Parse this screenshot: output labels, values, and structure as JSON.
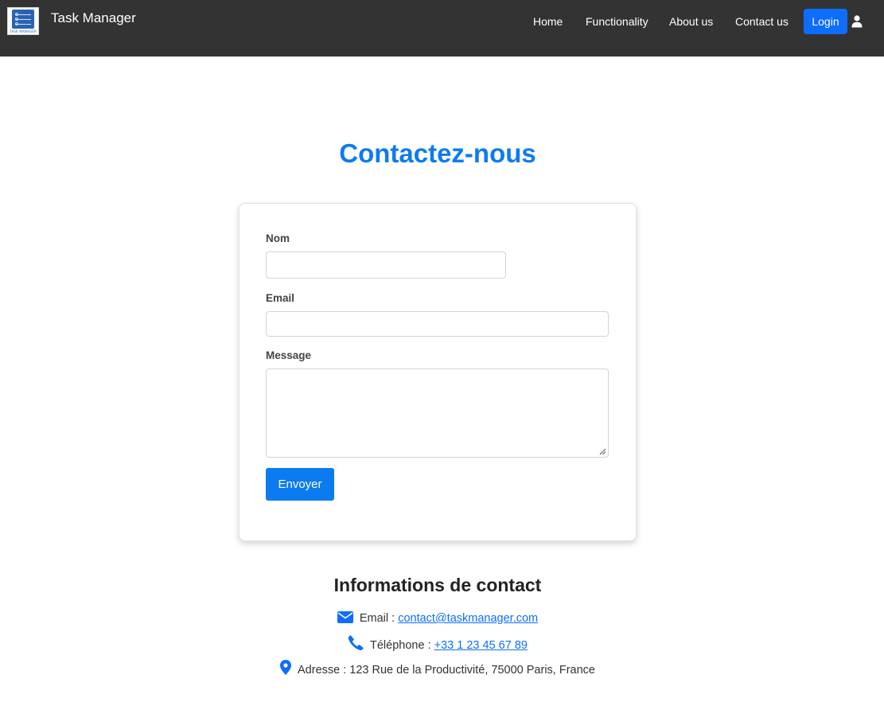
{
  "navbar": {
    "logo_caption": "TASK MANAGER",
    "brand": "Task Manager",
    "links": [
      "Home",
      "Functionality",
      "About us",
      "Contact us"
    ],
    "login_label": "Login",
    "icons": {
      "user": "user-icon"
    }
  },
  "main": {
    "title": "Contactez-nous",
    "form": {
      "name_label": "Nom",
      "name_value": "",
      "email_label": "Email",
      "email_value": "",
      "message_label": "Message",
      "message_value": "",
      "submit_label": "Envoyer"
    },
    "contact_info": {
      "title": "Informations de contact",
      "email_prefix": "Email : ",
      "email": "contact@taskmanager.com",
      "phone_prefix": "Téléphone : ",
      "phone": "+33 1 23 45 67 89",
      "address": "Adresse : 123 Rue de la Productivité, 75000 Paris, France",
      "icons": [
        "envelope-icon",
        "phone-icon",
        "map-pin-icon"
      ]
    }
  },
  "colors": {
    "navbar_bg": "#333333",
    "primary": "#0d6efd",
    "title_blue": "#0d7bf0"
  }
}
